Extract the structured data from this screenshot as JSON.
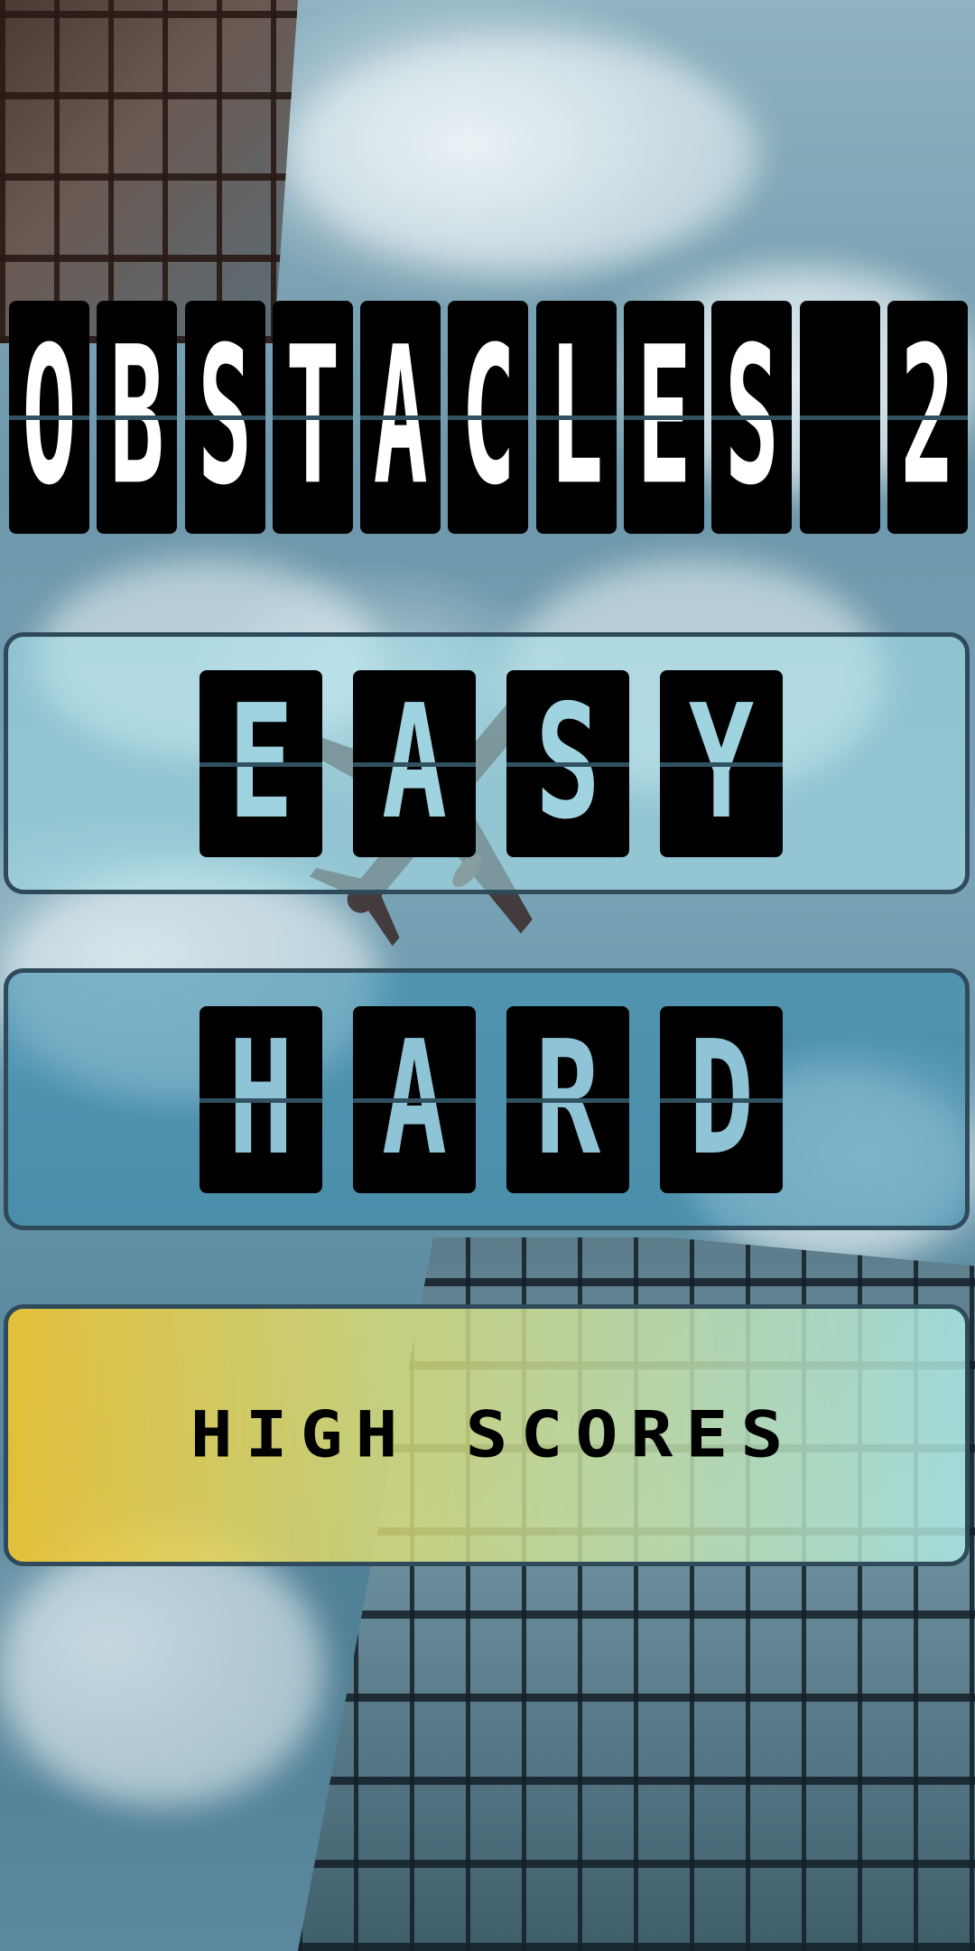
{
  "title": {
    "letters": [
      "O",
      "B",
      "S",
      "T",
      "A",
      "C",
      "L",
      "E",
      "S",
      " ",
      "2"
    ]
  },
  "menu": {
    "easy": {
      "letters": [
        "E",
        "A",
        "S",
        "Y"
      ]
    },
    "hard": {
      "letters": [
        "H",
        "A",
        "R",
        "D"
      ]
    },
    "high_scores": {
      "label": "HIGH SCORES"
    }
  },
  "colors": {
    "flap_background": "#000000",
    "title_text": "#ffffff",
    "button_border": "#2f4a5a",
    "easy_button": "#aae1eb",
    "hard_button": "#378caf",
    "scores_gradient_start": "#eec432",
    "scores_gradient_end": "#afebe6"
  },
  "icons": {
    "background_scene": "sky-with-skyscrapers-and-airplane"
  }
}
